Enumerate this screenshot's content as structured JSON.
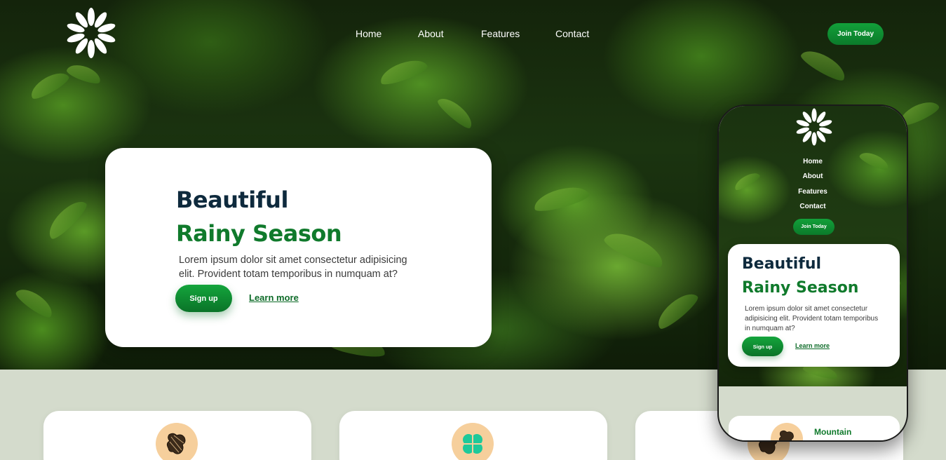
{
  "nav": {
    "items": [
      "Home",
      "About",
      "Features",
      "Contact"
    ],
    "join_label": "Join Today"
  },
  "hero": {
    "title_line1": "Beautiful",
    "title_line2": "Rainy Season",
    "description": "Lorem ipsum dolor sit amet consectetur adipisicing elit. Provident totam temporibus in numquam at?",
    "signup_label": "Sign up",
    "learn_label": "Learn more"
  },
  "phone": {
    "nav_items": [
      "Home",
      "About",
      "Features",
      "Contact"
    ],
    "join_label": "Join Today",
    "title_line1": "Beautiful",
    "title_line2": "Rainy Season",
    "description": "Lorem ipsum dolor sit amet consectetur adipisicing elit. Provident totam temporibus in numquam at?",
    "signup_label": "Sign up",
    "learn_label": "Learn more",
    "feature_title": "Mountain"
  },
  "features": [
    {
      "icon": "mountain-icon"
    },
    {
      "icon": "clover-icon"
    },
    {
      "icon": "mountain-icon"
    }
  ],
  "colors": {
    "brand_green": "#107a2c",
    "navy": "#0e2a3d",
    "section_bg": "#d4dbcc",
    "icon_bg": "#f6cf9c"
  }
}
